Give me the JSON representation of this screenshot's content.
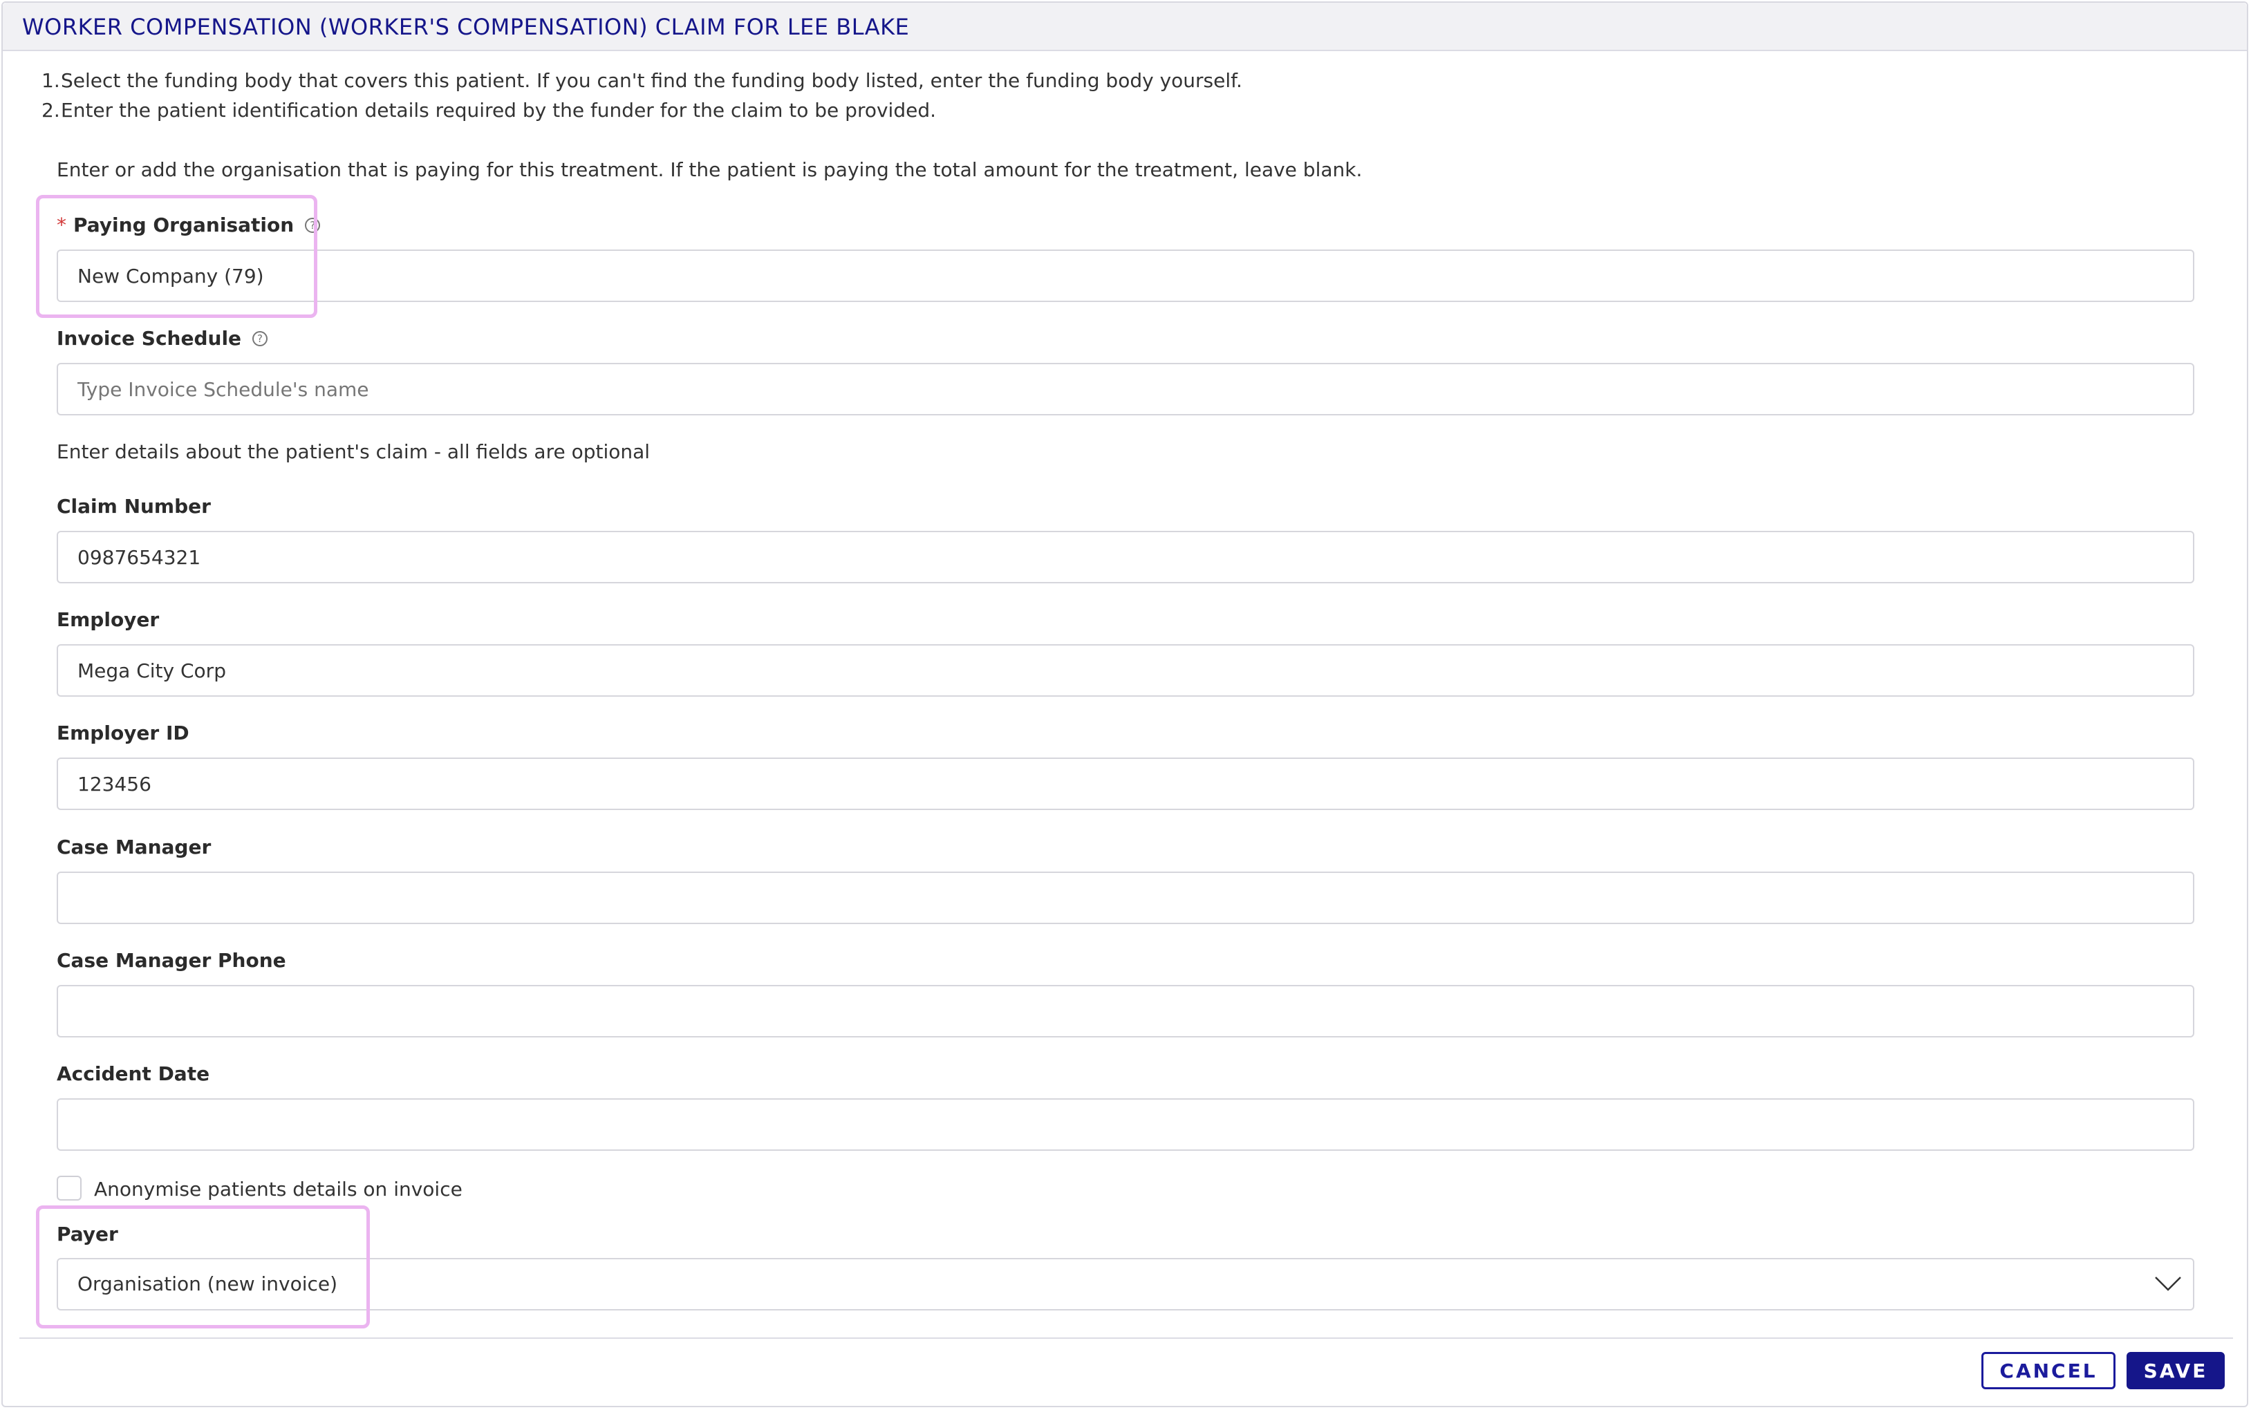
{
  "dialog": {
    "title": "WORKER COMPENSATION (WORKER'S COMPENSATION) CLAIM FOR LEE BLAKE"
  },
  "instructions": [
    {
      "num": "1.",
      "text": "Select the funding body that covers this patient. If you can't find the funding body listed, enter the funding body yourself."
    },
    {
      "num": "2.",
      "text": "Enter the patient identification details required by the funder for the claim to be provided."
    }
  ],
  "intro_text": "Enter or add the organisation that is paying for this treatment. If the patient is paying the total amount for the treatment, leave blank.",
  "paying_organisation": {
    "required_mark": "*",
    "label": "Paying Organisation",
    "value": "New Company (79)"
  },
  "invoice_schedule": {
    "label": "Invoice Schedule",
    "value": "",
    "placeholder": "Type Invoice Schedule's name"
  },
  "claim_intro": "Enter details about the patient's claim - all fields are optional",
  "claim_number": {
    "label": "Claim Number",
    "value": "0987654321"
  },
  "employer": {
    "label": "Employer",
    "value": "Mega City Corp"
  },
  "employer_id": {
    "label": "Employer ID",
    "value": "123456"
  },
  "case_manager": {
    "label": "Case Manager",
    "value": ""
  },
  "case_manager_phone": {
    "label": "Case Manager Phone",
    "value": ""
  },
  "accident_date": {
    "label": "Accident Date",
    "value": ""
  },
  "anonymise": {
    "label": "Anonymise patients details on invoice",
    "checked": false
  },
  "payer": {
    "label": "Payer",
    "value": "Organisation (new invoice)"
  },
  "help_icon_glyph": "?",
  "icons": {
    "help": "question-circle-icon",
    "dropdown": "chevron-down-icon"
  },
  "buttons": {
    "cancel": "CANCEL",
    "save": "SAVE"
  },
  "colors": {
    "brand": "#15168a",
    "required": "#d23a3a",
    "highlight": "#ebb4f0"
  }
}
